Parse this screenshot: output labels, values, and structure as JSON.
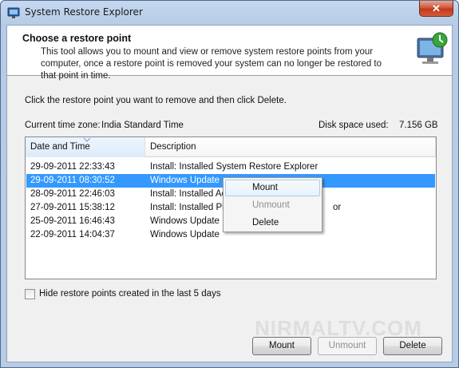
{
  "window": {
    "title": "System Restore Explorer",
    "close_glyph": "✕"
  },
  "header": {
    "title": "Choose a restore point",
    "description": "This tool allows you to mount and view or remove system restore points from your computer, once a restore point is removed your system can no longer be restored to that point in time.",
    "icon": "system-restore-monitor-icon"
  },
  "main": {
    "instruction": "Click the restore point you want to remove and then click Delete.",
    "timezone_label": "Current time zone:",
    "timezone_value": "India Standard Time",
    "disk_label": "Disk space used:",
    "disk_value": "7.156 GB"
  },
  "list": {
    "columns": [
      "Date and Time",
      "Description"
    ],
    "rows": [
      {
        "date": "29-09-2011 22:33:43",
        "desc": "Install: Installed System Restore Explorer"
      },
      {
        "date": "29-09-2011 08:30:52",
        "desc": "Windows Update"
      },
      {
        "date": "28-09-2011 22:46:03",
        "desc": "Install: Installed Aer"
      },
      {
        "date": "27-09-2011 15:38:12",
        "desc": "Install: Installed Pix"
      },
      {
        "date": "25-09-2011 16:46:43",
        "desc": "Windows Update"
      },
      {
        "date": "22-09-2011 14:04:37",
        "desc": "Windows Update"
      }
    ],
    "row4_overflow": "or",
    "selected_index": 1
  },
  "checkbox": {
    "label": "Hide restore points created in the last 5 days",
    "checked": false
  },
  "buttons": {
    "mount": "Mount",
    "unmount": "Unmount",
    "delete": "Delete"
  },
  "context_menu": {
    "items": [
      "Mount",
      "Unmount",
      "Delete"
    ]
  },
  "watermark": "NIRMALTV.COM",
  "colors": {
    "selection": "#3399ff",
    "accent": "#4b6b92"
  }
}
